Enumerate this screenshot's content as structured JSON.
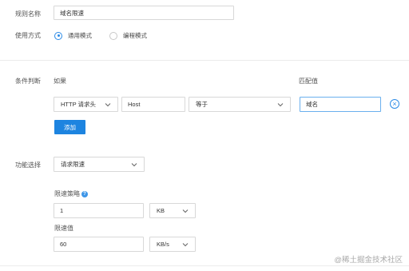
{
  "rule_name": {
    "label": "规则名称",
    "value": "域名限速"
  },
  "usage_mode": {
    "label": "使用方式",
    "options": [
      {
        "label": "通用模式",
        "selected": true
      },
      {
        "label": "编程模式",
        "selected": false
      }
    ]
  },
  "condition": {
    "label": "条件判断",
    "if_label": "如果",
    "match_label": "匹配值",
    "header_type": "HTTP 请求头",
    "header_name": "Host",
    "operator": "等于",
    "match_value": "域名",
    "add_button": "添加"
  },
  "function": {
    "label": "功能选择",
    "selected": "请求限速",
    "strategy_label": "限速策略",
    "strategy_value": "1",
    "strategy_unit": "KB",
    "limit_label": "限速值",
    "limit_value": "60",
    "limit_unit": "KB/s"
  },
  "watermark": "@稀土掘金技术社区",
  "icons": {
    "radio": "radio-icon",
    "chevron": "chevron-down-icon",
    "help": "question-icon",
    "remove": "close-circle-icon"
  },
  "colors": {
    "accent": "#1d84e0",
    "border": "#d8d8d8"
  }
}
